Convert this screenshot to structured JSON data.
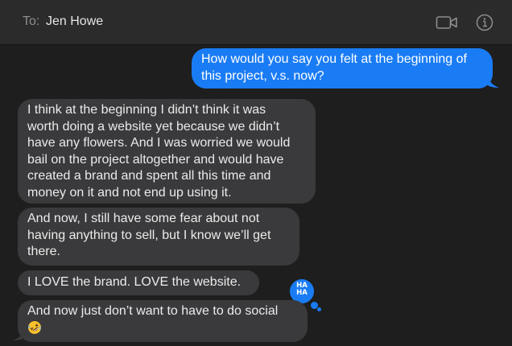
{
  "header": {
    "to_label": "To:",
    "recipient": "Jen Howe",
    "video_icon": "video-camera-icon",
    "info_icon": "info-circle-icon"
  },
  "messages": [
    {
      "direction": "outgoing",
      "lines": [
        "How would you say you felt at the beginning of",
        "this project, v.s. now?"
      ]
    },
    {
      "direction": "incoming",
      "lines": [
        "I think at the beginning I didn’t think it was",
        "worth doing a website yet because we didn’t",
        "have any flowers. And I was worried we would",
        "bail on the project altogether and would have",
        "created a brand and spent all this time and",
        "money on it and not end up using it."
      ]
    },
    {
      "direction": "incoming",
      "lines": [
        "And now, I still have some fear about not",
        "having anything to sell, but I know we’ll get",
        "there."
      ]
    },
    {
      "direction": "incoming",
      "lines": [
        "I LOVE the brand. LOVE the website."
      ],
      "tapback": {
        "icon": "haha-tapback-icon",
        "text_top": "HA",
        "text_bottom": "HA"
      }
    },
    {
      "direction": "incoming",
      "lines": [
        "And now just don’t want to have to do social"
      ],
      "emoji": "rolling-on-floor-laughing-emoji"
    }
  ],
  "colors": {
    "outgoing_bubble": "#1a7cf5",
    "incoming_bubble": "#3a3a3c",
    "background": "#1e1e1e",
    "header": "#2b2b2b"
  }
}
